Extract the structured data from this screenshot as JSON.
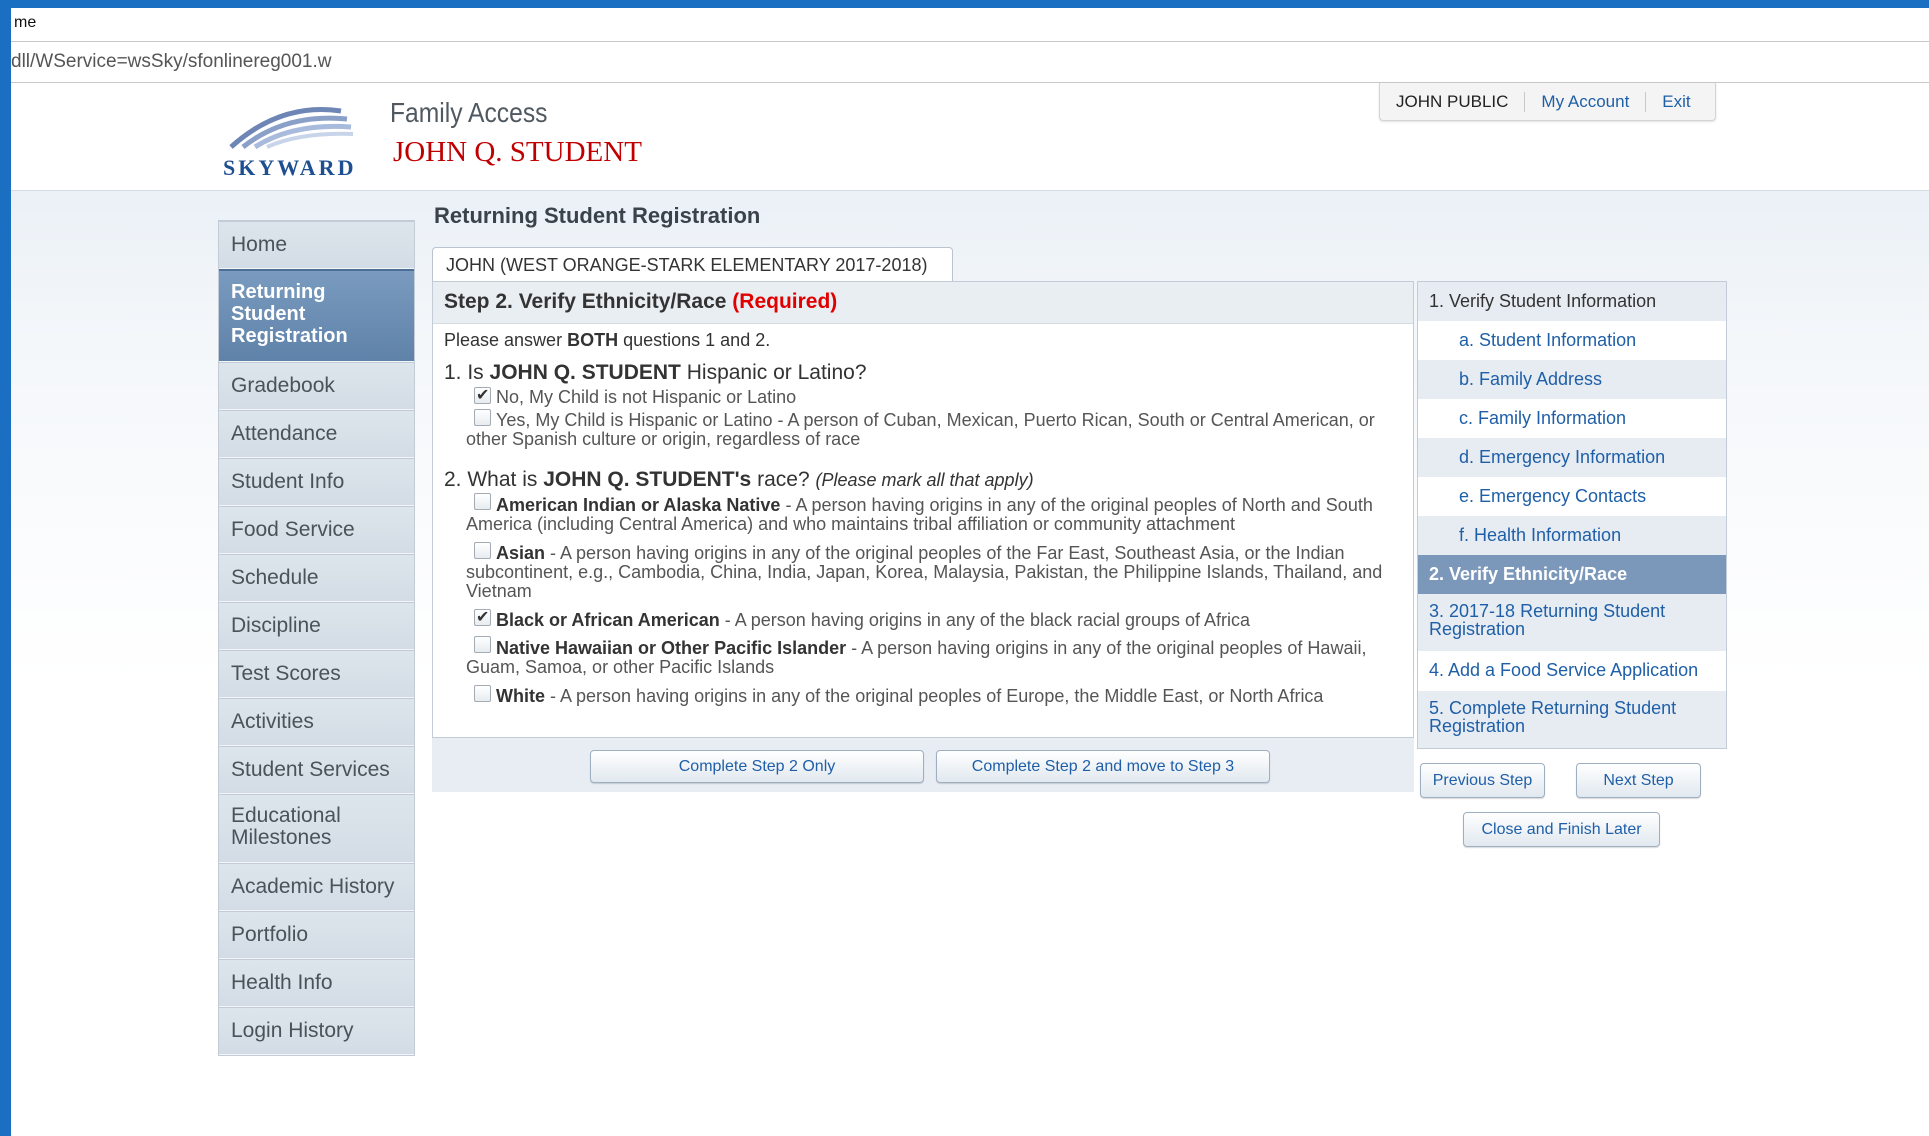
{
  "browser": {
    "title": "me",
    "address": "dll/WService=wsSky/sfonlinereg001.w"
  },
  "header": {
    "logo_text": "SKYWARD",
    "app_name": "Family Access",
    "student_name": "JOHN Q. STUDENT",
    "user_name": "JOHN PUBLIC",
    "my_account": "My Account",
    "exit": "Exit"
  },
  "nav": {
    "items": [
      {
        "label": "Home"
      },
      {
        "label": "Returning Student Registration",
        "active": true
      },
      {
        "label": "Gradebook"
      },
      {
        "label": "Attendance"
      },
      {
        "label": "Student Info"
      },
      {
        "label": "Food Service"
      },
      {
        "label": "Schedule"
      },
      {
        "label": "Discipline"
      },
      {
        "label": "Test Scores"
      },
      {
        "label": "Activities"
      },
      {
        "label": "Student Services"
      },
      {
        "label": "Educational Milestones"
      },
      {
        "label": "Academic History"
      },
      {
        "label": "Portfolio"
      },
      {
        "label": "Health Info"
      },
      {
        "label": "Login History"
      }
    ]
  },
  "main": {
    "page_title": "Returning Student Registration",
    "tab_label": "JOHN (WEST ORANGE-STARK ELEMENTARY 2017-2018)",
    "step_title": "Step 2. Verify Ethnicity/Race",
    "required": "(Required)",
    "intro_pre": "Please answer",
    "intro_bold": "BOTH",
    "intro_post": "questions 1 and 2.",
    "q1": {
      "pre": "1. Is",
      "name": "JOHN Q. STUDENT",
      "post": "Hispanic or Latino?"
    },
    "q1_options": [
      {
        "label": "No, My Child is not Hispanic or Latino",
        "checked": true
      },
      {
        "label": "Yes, My Child is Hispanic or Latino - A person of Cuban, Mexican, Puerto Rican, South or Central American, or other Spanish culture or origin, regardless of race",
        "checked": false
      }
    ],
    "q2": {
      "pre": "2. What is",
      "name": "JOHN Q. STUDENT's",
      "post": "race?",
      "note": "(Please mark all that apply)"
    },
    "q2_options": [
      {
        "name": "American Indian or Alaska Native",
        "desc": " - A person having origins in any of the original peoples of North and South America (including Central America) and who maintains tribal affiliation or community attachment",
        "checked": false
      },
      {
        "name": "Asian",
        "desc": " - A person having origins in any of the original peoples of the Far East, Southeast Asia, or the Indian subcontinent, e.g., Cambodia, China, India, Japan, Korea, Malaysia, Pakistan, the Philippine Islands, Thailand, and Vietnam",
        "checked": false
      },
      {
        "name": "Black or African American",
        "desc": " - A person having origins in any of the black racial groups of Africa",
        "checked": true
      },
      {
        "name": "Native Hawaiian or Other Pacific Islander",
        "desc": " - A person having origins in any of the original peoples of Hawaii, Guam, Samoa, or other Pacific Islands",
        "checked": false
      },
      {
        "name": "White",
        "desc": " - A person having origins in any of the original peoples of Europe, the Middle East, or North Africa",
        "checked": false
      }
    ],
    "btn_complete_only": "Complete Step 2 Only",
    "btn_complete_next": "Complete Step 2 and move to Step 3"
  },
  "steps": {
    "items": [
      {
        "label": "1. Verify Student Information"
      },
      {
        "label": "a. Student Information"
      },
      {
        "label": "b. Family Address"
      },
      {
        "label": "c. Family Information"
      },
      {
        "label": "d. Emergency Information"
      },
      {
        "label": "e. Emergency Contacts"
      },
      {
        "label": "f. Health Information"
      },
      {
        "label": "2. Verify Ethnicity/Race",
        "current": true
      },
      {
        "label": "3. 2017-18 Returning Student Registration"
      },
      {
        "label": "4. Add a Food Service Application"
      },
      {
        "label": "5. Complete Returning Student Registration"
      }
    ],
    "prev": "Previous Step",
    "next": "Next Step",
    "close": "Close and Finish Later"
  },
  "colors": {
    "accent": "#1f5fa8",
    "required": "#e00000",
    "student_name": "#c00000",
    "nav_active": "#6a8cb3",
    "window_border": "#1a6fc2"
  }
}
